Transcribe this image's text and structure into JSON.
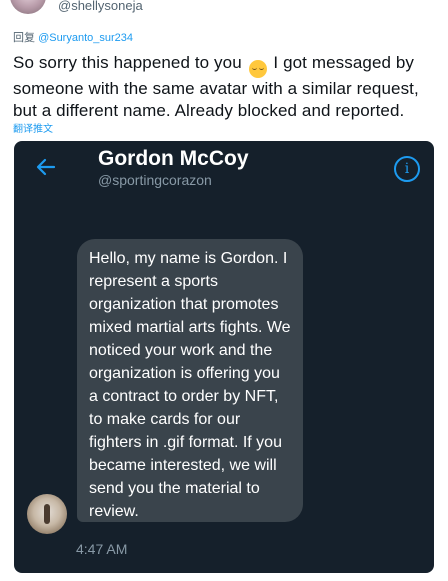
{
  "tweet": {
    "handle": "@shellysoneja",
    "reply_prefix": "回复",
    "reply_mention": "@Suryanto_sur234",
    "text_before_emoji": "So sorry this happened to you",
    "emoji": "😔",
    "text_after_emoji": " I got messaged by someone with the same avatar with a similar request, but a different name. Already blocked and reported.",
    "translate_label": "翻译推文"
  },
  "dm": {
    "back_icon": "arrow-left-icon",
    "contact_name": "Gordon McCoy",
    "contact_handle": "@sportingcorazon",
    "info_icon": "i",
    "message_text": "Hello, my name is Gordon. I represent a sports organization that promotes mixed martial arts fights. We noticed your work and the organization is offering you a contract to order by NFT, to make cards for our fighters in .gif format. If you became interested, we will send you the material to review.",
    "message_time": "4:47 AM"
  },
  "colors": {
    "dm_background": "#15202b",
    "bubble": "#3a444c",
    "accent": "#1d9bf0",
    "muted": "#8899a6"
  }
}
